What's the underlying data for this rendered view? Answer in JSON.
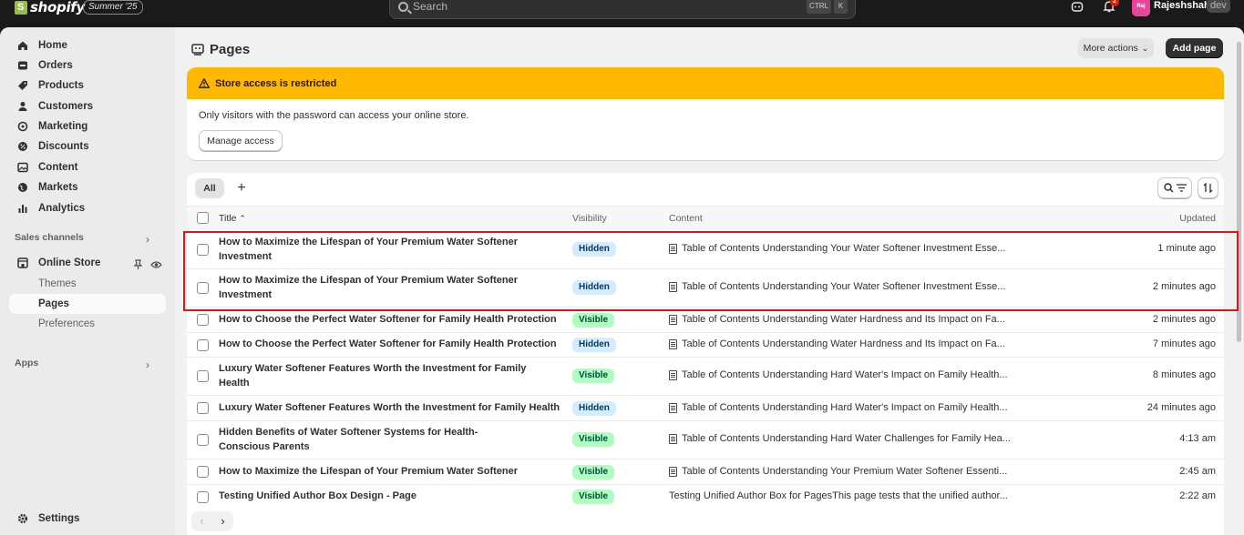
{
  "topbar": {
    "brand": "shopify",
    "edition": "Summer '25",
    "search_placeholder": "Search",
    "shortcut_key1": "CTRL",
    "shortcut_key2": "K",
    "notification_count": "2",
    "avatar_initials": "Raj",
    "user_name": "Rajeshshah",
    "store_tag": "dev"
  },
  "sidebar": {
    "items": [
      {
        "label": "Home",
        "icon": "home-icon"
      },
      {
        "label": "Orders",
        "icon": "orders-icon"
      },
      {
        "label": "Products",
        "icon": "tag-icon"
      },
      {
        "label": "Customers",
        "icon": "person-icon"
      },
      {
        "label": "Marketing",
        "icon": "target-icon"
      },
      {
        "label": "Discounts",
        "icon": "discount-icon"
      },
      {
        "label": "Content",
        "icon": "image-icon"
      },
      {
        "label": "Markets",
        "icon": "globe-icon"
      },
      {
        "label": "Analytics",
        "icon": "bar-chart-icon"
      }
    ],
    "sales_channels_label": "Sales channels",
    "online_store_label": "Online Store",
    "online_store_sub": [
      "Themes",
      "Pages",
      "Preferences"
    ],
    "apps_label": "Apps",
    "settings_label": "Settings"
  },
  "page": {
    "title": "Pages",
    "more_actions_label": "More actions",
    "add_page_label": "Add page"
  },
  "banner": {
    "title": "Store access is restricted",
    "text": "Only visitors with the password can access your online store.",
    "button_label": "Manage access"
  },
  "table": {
    "tab_all": "All",
    "tab_add": "+",
    "headers": {
      "title": "Title",
      "visibility": "Visibility",
      "content": "Content",
      "updated": "Updated"
    },
    "rows": [
      {
        "title": "How to Maximize the Lifespan of Your Premium Water Softener Investment",
        "visibility": "Hidden",
        "content": "Table of Contents Understanding Your Water Softener Investment Esse...",
        "updated": "1 minute ago",
        "doc": true
      },
      {
        "title": "How to Maximize the Lifespan of Your Premium Water Softener Investment",
        "visibility": "Hidden",
        "content": "Table of Contents Understanding Your Water Softener Investment Esse...",
        "updated": "2 minutes ago",
        "doc": true
      },
      {
        "title": "How to Choose the Perfect Water Softener for Family Health Protection",
        "visibility": "Visible",
        "content": "Table of Contents Understanding Water Hardness and Its Impact on Fa...",
        "updated": "2 minutes ago",
        "doc": true
      },
      {
        "title": "How to Choose the Perfect Water Softener for Family Health Protection",
        "visibility": "Hidden",
        "content": "Table of Contents Understanding Water Hardness and Its Impact on Fa...",
        "updated": "7 minutes ago",
        "doc": true
      },
      {
        "title": "Luxury Water Softener Features Worth the Investment for Family Health",
        "visibility": "Visible",
        "content": "Table of Contents Understanding Hard Water's Impact on Family Health...",
        "updated": "8 minutes ago",
        "doc": true
      },
      {
        "title": "Luxury Water Softener Features Worth the Investment for Family Health",
        "visibility": "Hidden",
        "content": "Table of Contents Understanding Hard Water's Impact on Family Health...",
        "updated": "24 minutes ago",
        "doc": true
      },
      {
        "title": "Hidden Benefits of Water Softener Systems for Health-Conscious Parents",
        "visibility": "Visible",
        "content": "Table of Contents Understanding Hard Water Challenges for Family Hea...",
        "updated": "4:13 am",
        "doc": true
      },
      {
        "title": "How to Maximize the Lifespan of Your Premium Water Softener",
        "visibility": "Visible",
        "content": "Table of Contents Understanding Your Premium Water Softener Essenti...",
        "updated": "2:45 am",
        "doc": true
      },
      {
        "title": "Testing Unified Author Box Design - Page",
        "visibility": "Visible",
        "content": "Testing Unified Author Box for PagesThis page tests that the unified author...",
        "updated": "2:22 am",
        "doc": false
      }
    ]
  },
  "colors": {
    "topbar": "#1a1a1a",
    "banner_warning": "#ffb800",
    "badge_hidden": "#d5ebff",
    "badge_visible": "#affebf",
    "highlight_box": "#e8101a"
  }
}
